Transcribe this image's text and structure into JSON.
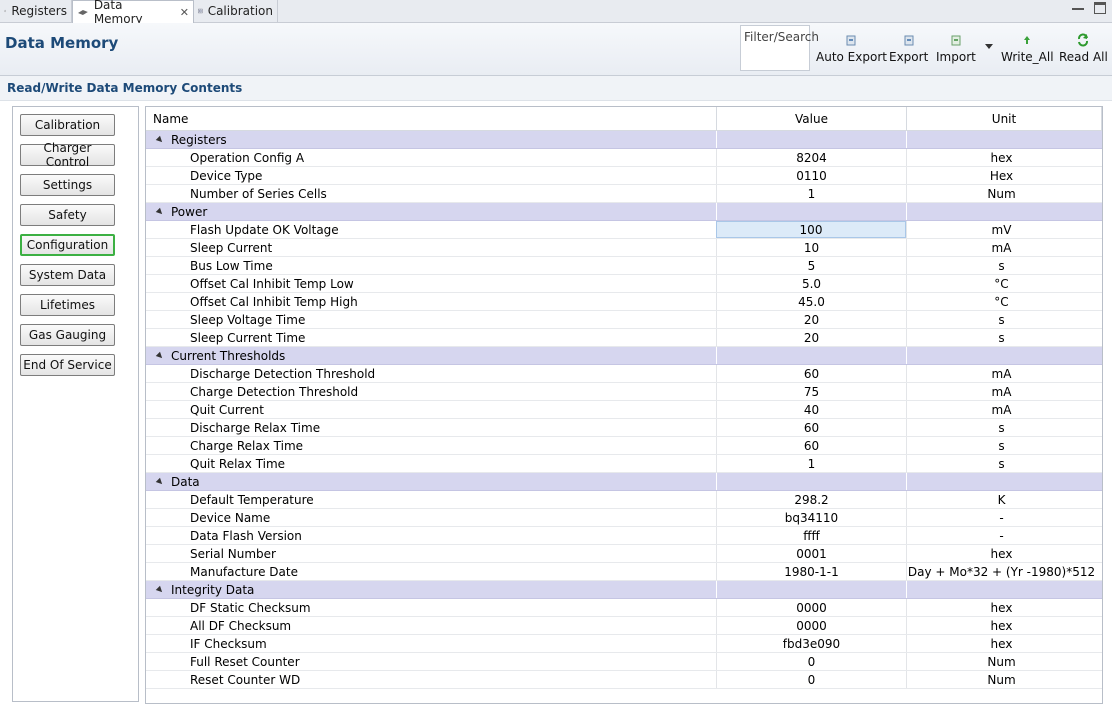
{
  "tabs": [
    {
      "label": "Registers",
      "icon": "gear-icon",
      "active": false
    },
    {
      "label": "Data Memory",
      "icon": "chip-icon",
      "active": true
    },
    {
      "label": "Calibration",
      "icon": "calibration-icon",
      "active": false
    }
  ],
  "header": {
    "title": "Data Memory",
    "filter_label": "Filter/Search",
    "buttons": [
      {
        "label": "Auto Export",
        "icon": "export-icon"
      },
      {
        "label": "Export",
        "icon": "export-icon"
      },
      {
        "label": "Import",
        "icon": "import-icon"
      },
      {
        "label": "Write_All",
        "icon": "arrow-up-icon"
      },
      {
        "label": "Read All",
        "icon": "refresh-icon"
      }
    ]
  },
  "section_title": "Read/Write Data Memory Contents",
  "nav": {
    "buttons": [
      "Calibration",
      "Charger Control",
      "Settings",
      "Safety",
      "Configuration",
      "System Data",
      "Lifetimes",
      "Gas Gauging",
      "End Of Service"
    ],
    "active": "Configuration"
  },
  "table": {
    "columns": {
      "name": "Name",
      "value": "Value",
      "unit": "Unit"
    },
    "groups": [
      {
        "name": "Registers",
        "rows": [
          [
            "Operation Config A",
            "8204",
            "hex"
          ],
          [
            "Device Type",
            "0110",
            "Hex"
          ],
          [
            "Number of Series Cells",
            "1",
            "Num"
          ]
        ]
      },
      {
        "name": "Power",
        "rows": [
          [
            "Flash Update OK Voltage",
            "100",
            "mV"
          ],
          [
            "Sleep Current",
            "10",
            "mA"
          ],
          [
            "Bus Low Time",
            "5",
            "s"
          ],
          [
            "Offset Cal Inhibit Temp Low",
            "5.0",
            "°C"
          ],
          [
            "Offset Cal Inhibit Temp High",
            "45.0",
            "°C"
          ],
          [
            "Sleep Voltage Time",
            "20",
            "s"
          ],
          [
            "Sleep Current Time",
            "20",
            "s"
          ]
        ]
      },
      {
        "name": "Current Thresholds",
        "rows": [
          [
            "Discharge Detection Threshold",
            "60",
            "mA"
          ],
          [
            "Charge Detection Threshold",
            "75",
            "mA"
          ],
          [
            "Quit Current",
            "40",
            "mA"
          ],
          [
            "Discharge Relax Time",
            "60",
            "s"
          ],
          [
            "Charge Relax Time",
            "60",
            "s"
          ],
          [
            "Quit Relax Time",
            "1",
            "s"
          ]
        ]
      },
      {
        "name": "Data",
        "rows": [
          [
            "Default Temperature",
            "298.2",
            "K"
          ],
          [
            "Device Name",
            "bq34110",
            "-"
          ],
          [
            "Data Flash Version",
            "ffff",
            "-"
          ],
          [
            "Serial Number",
            "0001",
            "hex"
          ],
          [
            "Manufacture Date",
            "1980-1-1",
            "Day + Mo*32 + (Yr -1980)*512"
          ]
        ]
      },
      {
        "name": "Integrity Data",
        "rows": [
          [
            "DF Static Checksum",
            "0000",
            "hex"
          ],
          [
            "All DF Checksum",
            "0000",
            "hex"
          ],
          [
            "IF Checksum",
            "fbd3e090",
            "hex"
          ],
          [
            "Full Reset Counter",
            "0",
            "Num"
          ],
          [
            "Reset Counter WD",
            "0",
            "Num"
          ]
        ]
      }
    ],
    "selected_cell": "Flash Update OK Voltage"
  },
  "colors": {
    "title": "#1d4a78",
    "group_row": "#d6d6ef",
    "active_nav_border": "#3cb043",
    "selected_cell": "#dceaf8"
  }
}
